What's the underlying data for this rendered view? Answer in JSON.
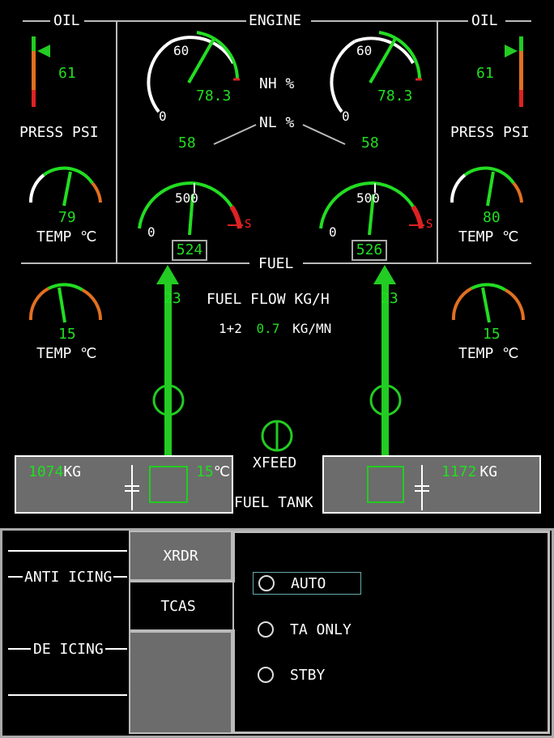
{
  "sections": {
    "oil": "OIL",
    "engine": "ENGINE",
    "fuel": "FUEL"
  },
  "oil_left": {
    "press_value": "61",
    "press_label": "PRESS PSI",
    "temp_value": "79",
    "temp_label": "TEMP ℃"
  },
  "oil_right": {
    "press_value": "61",
    "press_label": "PRESS PSI",
    "temp_value": "80",
    "temp_label": "TEMP ℃"
  },
  "engine": {
    "nh_label": "NH %",
    "nl_label": "NL %",
    "left": {
      "nh_scale_max": "60",
      "nh_scale_min": "0",
      "nh_value": "78.3",
      "nl_value": "58",
      "itt_scale_mid": "500",
      "itt_scale_min": "0",
      "itt_value": "524",
      "itt_mark": "S"
    },
    "right": {
      "nh_scale_max": "60",
      "nh_scale_min": "0",
      "nh_value": "78.3",
      "nl_value": "58",
      "itt_scale_mid": "500",
      "itt_scale_min": "0",
      "itt_value": "526",
      "itt_mark": "S"
    }
  },
  "fuel": {
    "flow_label": "FUEL FLOW KG/H",
    "left_flow": "23",
    "right_flow": "23",
    "total_prefix": "1+2",
    "total_value": "0.7",
    "total_unit": "KG/MN",
    "left_temp_value": "15",
    "left_temp_label": "TEMP ℃",
    "right_temp_value": "15",
    "right_temp_label": "TEMP ℃",
    "xfeed_label": "XFEED",
    "tank_label": "FUEL TANK",
    "left_tank": {
      "qty": "1074",
      "unit": "KG",
      "temp": "15",
      "temp_unit": "℃"
    },
    "right_tank": {
      "qty": "1172",
      "unit": "KG"
    }
  },
  "bottom": {
    "anti_icing": "ANTI ICING",
    "de_icing": "DE ICING",
    "tabs": {
      "xrdr": "XRDR",
      "tcas": "TCAS"
    },
    "options": [
      {
        "label": "AUTO"
      },
      {
        "label": "TA ONLY"
      },
      {
        "label": "STBY"
      }
    ]
  }
}
